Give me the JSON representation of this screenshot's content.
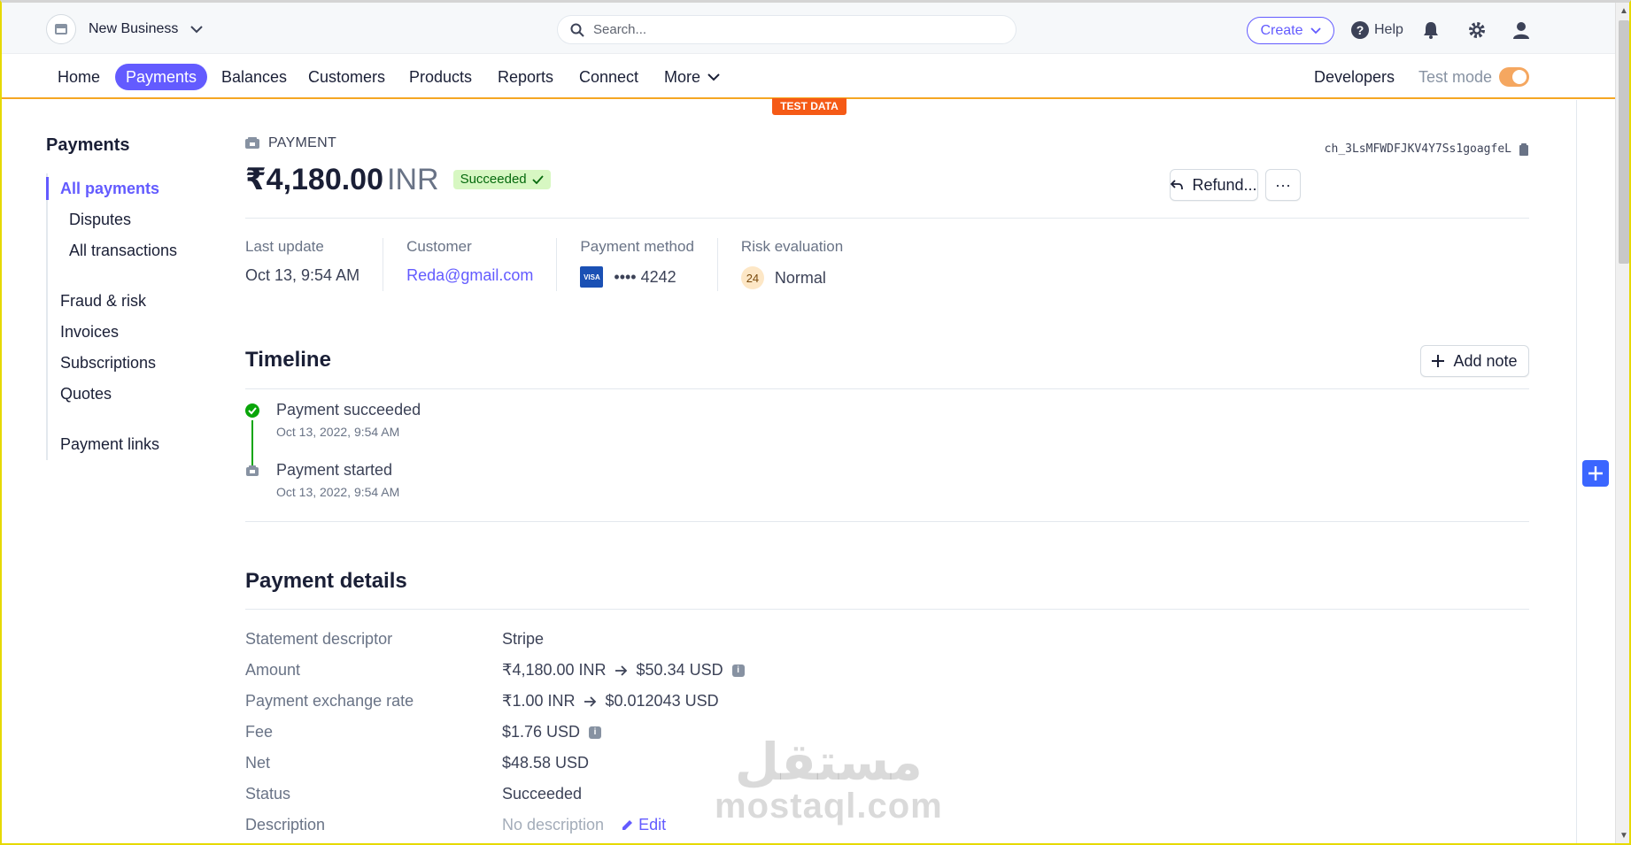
{
  "topbar": {
    "business_name": "New Business",
    "search_placeholder": "Search...",
    "create_label": "Create",
    "help_label": "Help"
  },
  "nav": {
    "items": [
      "Home",
      "Payments",
      "Balances",
      "Customers",
      "Products",
      "Reports",
      "Connect",
      "More"
    ],
    "active": "Payments",
    "developers": "Developers",
    "test_mode": "Test mode",
    "test_badge": "TEST DATA"
  },
  "sidebar": {
    "title": "Payments",
    "all_payments": "All payments",
    "disputes": "Disputes",
    "all_transactions": "All transactions",
    "fraud_risk": "Fraud & risk",
    "invoices": "Invoices",
    "subscriptions": "Subscriptions",
    "quotes": "Quotes",
    "payment_links": "Payment links"
  },
  "payment": {
    "label": "PAYMENT",
    "amount": "₹4,180.00",
    "currency": "INR",
    "status": "Succeeded",
    "charge_id": "ch_3LsMFWDFJKV4Y7Ss1goagfeL",
    "refund_label": "Refund...",
    "more_label": "···"
  },
  "summary": {
    "last_update_label": "Last update",
    "last_update": "Oct 13, 9:54 AM",
    "customer_label": "Customer",
    "customer": "Reda@gmail.com",
    "method_label": "Payment method",
    "card_brand": "VISA",
    "card_last4": "•••• 4242",
    "risk_label": "Risk evaluation",
    "risk_score": "24",
    "risk_level": "Normal"
  },
  "timeline": {
    "title": "Timeline",
    "add_note": "Add note",
    "events": [
      {
        "title": "Payment succeeded",
        "time": "Oct 13, 2022, 9:54 AM"
      },
      {
        "title": "Payment started",
        "time": "Oct 13, 2022, 9:54 AM"
      }
    ]
  },
  "details": {
    "title": "Payment details",
    "statement_descriptor_label": "Statement descriptor",
    "statement_descriptor": "Stripe",
    "amount_label": "Amount",
    "amount_from": "₹4,180.00 INR",
    "amount_to": "$50.34 USD",
    "rate_label": "Payment exchange rate",
    "rate_from": "₹1.00 INR",
    "rate_to": "$0.012043 USD",
    "fee_label": "Fee",
    "fee": "$1.76 USD",
    "net_label": "Net",
    "net": "$48.58 USD",
    "status_label": "Status",
    "status": "Succeeded",
    "description_label": "Description",
    "description": "No description",
    "edit_label": "Edit"
  },
  "watermark": {
    "arabic": "مستقل",
    "latin": "mostaql.com"
  },
  "colors": {
    "accent": "#635bff",
    "success": "#05690d",
    "test_orange": "#f55a16"
  }
}
